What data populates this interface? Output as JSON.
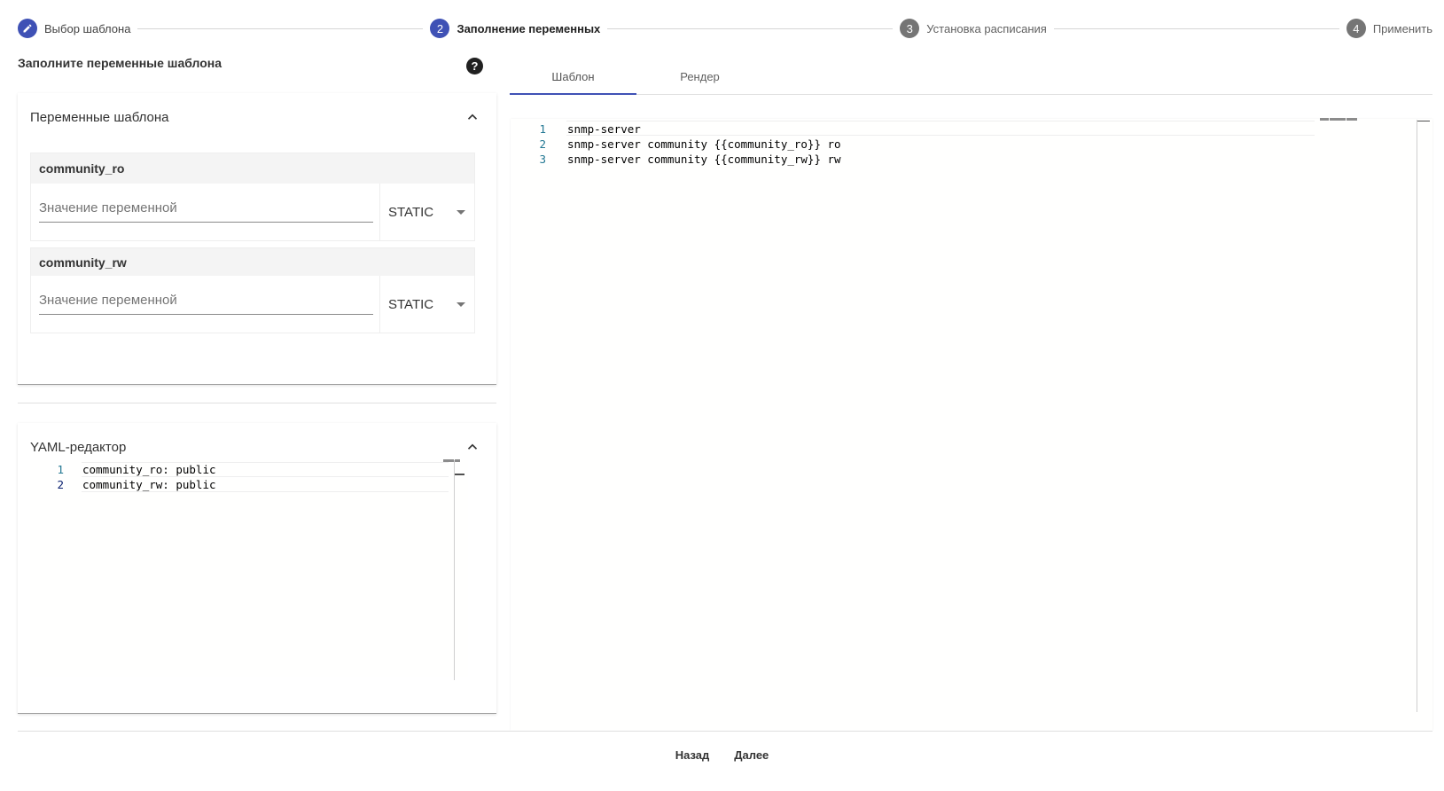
{
  "stepper": {
    "steps": [
      {
        "number": "",
        "icon": "pencil-icon",
        "label": "Выбор шаблона",
        "state": "done"
      },
      {
        "number": "2",
        "label": "Заполнение переменных",
        "state": "active"
      },
      {
        "number": "3",
        "label": "Установка расписания",
        "state": "inactive"
      },
      {
        "number": "4",
        "label": "Применить",
        "state": "inactive"
      }
    ]
  },
  "left": {
    "title": "Заполните переменные шаблона",
    "help_glyph": "?"
  },
  "variables_panel": {
    "header": "Переменные шаблона",
    "variables": [
      {
        "name": "community_ro",
        "placeholder": "Значение переменной",
        "value": "",
        "type": "STATIC"
      },
      {
        "name": "community_rw",
        "placeholder": "Значение переменной",
        "value": "",
        "type": "STATIC"
      }
    ]
  },
  "yaml_panel": {
    "header": "YAML-редактор",
    "lines": [
      {
        "number": "1",
        "text": "community_ro: public"
      },
      {
        "number": "2",
        "text": "community_rw: public"
      }
    ]
  },
  "tabs": {
    "items": [
      {
        "label": "Шаблон",
        "active": true
      },
      {
        "label": "Рендер",
        "active": false
      }
    ]
  },
  "template_editor": {
    "lines": [
      {
        "number": "1",
        "text": "snmp-server"
      },
      {
        "number": "2",
        "text": "snmp-server community {{community_ro}} ro"
      },
      {
        "number": "3",
        "text": "snmp-server community {{community_rw}} rw"
      }
    ]
  },
  "actions": {
    "back_label": "Назад",
    "next_label": "Далее"
  },
  "colors": {
    "accent": "#3f51b5",
    "inactive_step": "#757575",
    "line_number": "#237893"
  }
}
